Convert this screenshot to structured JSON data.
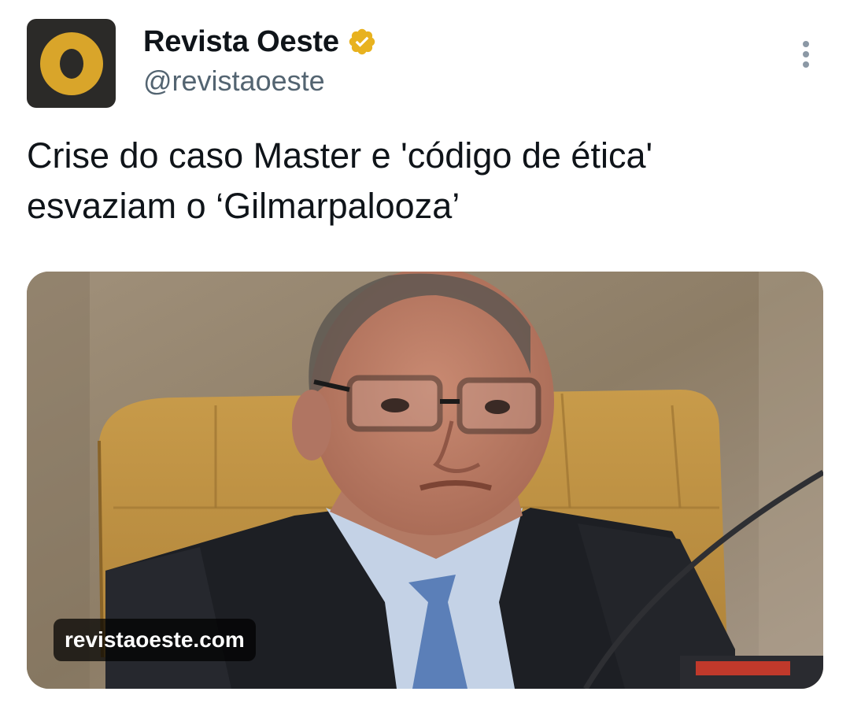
{
  "account": {
    "display_name": "Revista Oeste",
    "handle": "@revistaoeste",
    "avatar_icon": "revista-oeste-logo",
    "verified_icon": "verified-badge-icon",
    "verified_color": "#e8b21f"
  },
  "tweet": {
    "text": "Crise do caso Master e 'código de ética'\nesvaziam o ‘Gilmarpalooza’",
    "more_icon": "more-options-icon"
  },
  "media": {
    "domain_label": "revistaoeste.com",
    "image_icon": "news-photo"
  },
  "colors": {
    "text_primary": "#0f1419",
    "text_secondary": "#536471",
    "logo_yellow": "#d9a52a",
    "logo_bg": "#2b2a28"
  }
}
